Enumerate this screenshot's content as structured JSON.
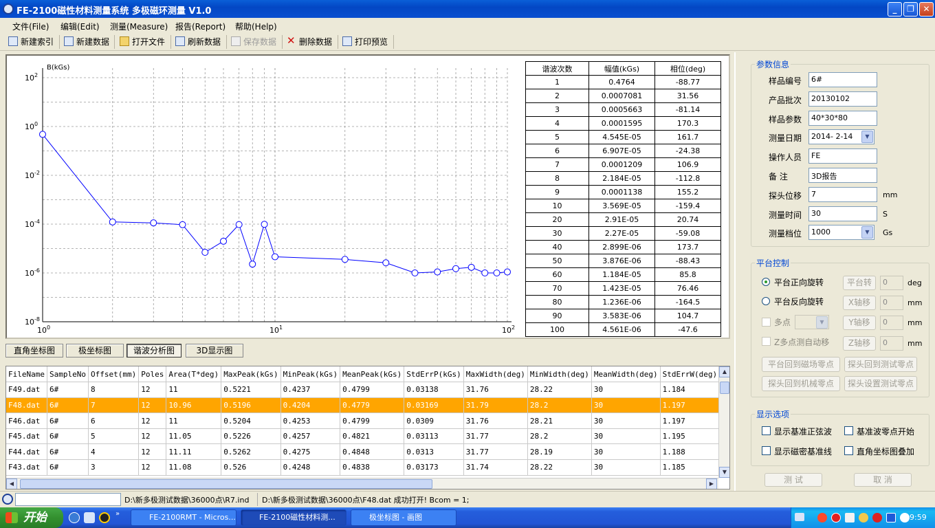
{
  "window": {
    "title": "FE-2100磁性材料测量系统  多极磁环测量 V1.0",
    "min_glyph": "_",
    "max_glyph": "❐",
    "close_glyph": "✕"
  },
  "menu": [
    "文件(File)",
    "编辑(Edit)",
    "测量(Measure)",
    "报告(Report)",
    "帮助(Help)"
  ],
  "toolbar": [
    {
      "label": "新建索引",
      "icon": "new-index-icon",
      "enabled": true
    },
    {
      "label": "新建数据",
      "icon": "new-data-icon",
      "enabled": true
    },
    {
      "label": "打开文件",
      "icon": "open-folder-icon",
      "enabled": true
    },
    {
      "label": "刷新数据",
      "icon": "refresh-icon",
      "enabled": true
    },
    {
      "label": "保存数据",
      "icon": "save-icon",
      "enabled": false
    },
    {
      "label": "删除数据",
      "icon": "delete-icon",
      "enabled": true
    },
    {
      "label": "打印预览",
      "icon": "print-preview-icon",
      "enabled": true
    }
  ],
  "chart_data": {
    "type": "line",
    "ylabel": "B(kGs)",
    "x_scale": "log",
    "y_scale": "log",
    "xlim": [
      1,
      100
    ],
    "ylim": [
      1e-08,
      100
    ],
    "x_ticks": [
      {
        "base": "10",
        "exp": "0"
      },
      {
        "base": "10",
        "exp": "1"
      },
      {
        "base": "10",
        "exp": "2"
      }
    ],
    "y_ticks": [
      {
        "base": "10",
        "exp": "2"
      },
      {
        "base": "10",
        "exp": "0"
      },
      {
        "base": "10",
        "exp": "-2"
      },
      {
        "base": "10",
        "exp": "-4"
      },
      {
        "base": "10",
        "exp": "-6"
      },
      {
        "base": "10",
        "exp": "-8"
      }
    ],
    "grid": true,
    "line_color": "#0000ff",
    "x": [
      1,
      2,
      3,
      4,
      5,
      6,
      7,
      8,
      9,
      10,
      20,
      30,
      40,
      50,
      60,
      70,
      80,
      90,
      100
    ],
    "y": [
      0.4764,
      0.0001228,
      0.0001125,
      9.5e-05,
      7e-06,
      2e-05,
      9.6e-05,
      2.3e-06,
      9.8e-05,
      4.6e-06,
      3.6e-06,
      2.6e-06,
      1e-06,
      1.1e-06,
      1.5e-06,
      1.7e-06,
      1e-06,
      1e-06,
      1.1e-06
    ]
  },
  "harmonic_table": {
    "headers": [
      "谐波次数",
      "幅值(kGs)",
      "相位(deg)"
    ],
    "rows": [
      [
        "1",
        "0.4764",
        "-88.77"
      ],
      [
        "2",
        "0.0007081",
        "31.56"
      ],
      [
        "3",
        "0.0005663",
        "-81.14"
      ],
      [
        "4",
        "0.0001595",
        "170.3"
      ],
      [
        "5",
        "4.545E-05",
        "161.7"
      ],
      [
        "6",
        "6.907E-05",
        "-24.38"
      ],
      [
        "7",
        "0.0001209",
        "106.9"
      ],
      [
        "8",
        "2.184E-05",
        "-112.8"
      ],
      [
        "9",
        "0.0001138",
        "155.2"
      ],
      [
        "10",
        "3.569E-05",
        "-159.4"
      ],
      [
        "20",
        "2.91E-05",
        "20.74"
      ],
      [
        "30",
        "2.27E-05",
        "-59.08"
      ],
      [
        "40",
        "2.899E-06",
        "173.7"
      ],
      [
        "50",
        "3.876E-06",
        "-88.43"
      ],
      [
        "60",
        "1.184E-05",
        "85.8"
      ],
      [
        "70",
        "1.423E-05",
        "76.46"
      ],
      [
        "80",
        "1.236E-06",
        "-164.5"
      ],
      [
        "90",
        "3.583E-06",
        "104.7"
      ],
      [
        "100",
        "4.561E-06",
        "-47.6"
      ]
    ]
  },
  "view_tabs": [
    {
      "label": "直角坐标图",
      "active": false
    },
    {
      "label": "极坐标图",
      "active": false
    },
    {
      "label": "谐波分析图",
      "active": true
    },
    {
      "label": "3D显示图",
      "active": false
    }
  ],
  "data_grid": {
    "headers": [
      "FileName",
      "SampleNo",
      "Offset(mm)",
      "Poles",
      "Area(T*deg)",
      "MaxPeak(kGs)",
      "MinPeak(kGs)",
      "MeanPeak(kGs)",
      "StdErrP(kGs)",
      "MaxWidth(deg)",
      "MinWidth(deg)",
      "MeanWidth(deg)",
      "StdErrW(deg)"
    ],
    "selected_row": 1,
    "rows": [
      [
        "F49.dat",
        "6#",
        "8",
        "12",
        "11",
        "0.5221",
        "0.4237",
        "0.4799",
        "0.03138",
        "31.76",
        "28.22",
        "30",
        "1.184"
      ],
      [
        "F48.dat",
        "6#",
        "7",
        "12",
        "10.96",
        "0.5196",
        "0.4204",
        "0.4779",
        "0.03169",
        "31.79",
        "28.2",
        "30",
        "1.197"
      ],
      [
        "F46.dat",
        "6#",
        "6",
        "12",
        "11",
        "0.5204",
        "0.4253",
        "0.4799",
        "0.0309",
        "31.76",
        "28.21",
        "30",
        "1.197"
      ],
      [
        "F45.dat",
        "6#",
        "5",
        "12",
        "11.05",
        "0.5226",
        "0.4257",
        "0.4821",
        "0.03113",
        "31.77",
        "28.2",
        "30",
        "1.195"
      ],
      [
        "F44.dat",
        "6#",
        "4",
        "12",
        "11.11",
        "0.5262",
        "0.4275",
        "0.4848",
        "0.0313",
        "31.77",
        "28.19",
        "30",
        "1.188"
      ],
      [
        "F43.dat",
        "6#",
        "3",
        "12",
        "11.08",
        "0.526",
        "0.4248",
        "0.4838",
        "0.03173",
        "31.74",
        "28.22",
        "30",
        "1.185"
      ]
    ]
  },
  "params": {
    "legend": "参数信息",
    "fields": [
      {
        "label": "样品编号",
        "value": "6#",
        "unit": "",
        "dropdown": false
      },
      {
        "label": "产品批次",
        "value": "20130102",
        "unit": "",
        "dropdown": false
      },
      {
        "label": "样品参数",
        "value": "40*30*80",
        "unit": "",
        "dropdown": false
      },
      {
        "label": "测量日期",
        "value": "2014- 2-14",
        "unit": "",
        "dropdown": true
      },
      {
        "label": "操作人员",
        "value": "FE",
        "unit": "",
        "dropdown": false
      },
      {
        "label": "备    注",
        "value": "3D报告",
        "unit": "",
        "dropdown": false
      },
      {
        "label": "探头位移",
        "value": "7",
        "unit": "mm",
        "dropdown": false
      },
      {
        "label": "测量时间",
        "value": "30",
        "unit": "S",
        "dropdown": false
      },
      {
        "label": "测量档位",
        "value": "1000",
        "unit": "Gs",
        "dropdown": true
      }
    ]
  },
  "platform": {
    "legend": "平台控制",
    "forward": "平台正向旋转",
    "reverse": "平台反向旋转",
    "multipoint": "多点",
    "z_auto": "Z多点测自动移",
    "axis_rows": [
      {
        "button": "平台转",
        "value": "0",
        "unit": "deg"
      },
      {
        "button": "X轴移",
        "value": "0",
        "unit": "mm"
      },
      {
        "button": "Y轴移",
        "value": "0",
        "unit": "mm"
      },
      {
        "button": "Z轴移",
        "value": "0",
        "unit": "mm"
      }
    ],
    "buttons": [
      "平台回到磁场零点",
      "探头回到测试零点",
      "探头回到机械零点",
      "探头设置测试零点"
    ]
  },
  "display": {
    "legend": "显示选项",
    "options": [
      "显示基准正弦波",
      "基准波零点开始",
      "显示磁密基准线",
      "直角坐标图叠加"
    ]
  },
  "actions": {
    "test": "测  试",
    "cancel": "取  消"
  },
  "status": {
    "input": "",
    "path": "D:\\新多极测试数据\\36000点\\R7.ind",
    "message": "D:\\新多极测试数据\\36000点\\F48.dat 成功打开! Bcom = 1;"
  },
  "taskbar": {
    "start": "开始",
    "tasks": [
      {
        "label": "FE-2100RMT - Micros...",
        "active": false
      },
      {
        "label": "FE-2100磁性材料测...",
        "active": true
      },
      {
        "label": "极坐标图 - 画图",
        "active": false
      }
    ],
    "time": "9:59"
  },
  "colors": {
    "accent": "#0046d5",
    "selection": "#ffa500",
    "plot_line": "#0000ff"
  }
}
